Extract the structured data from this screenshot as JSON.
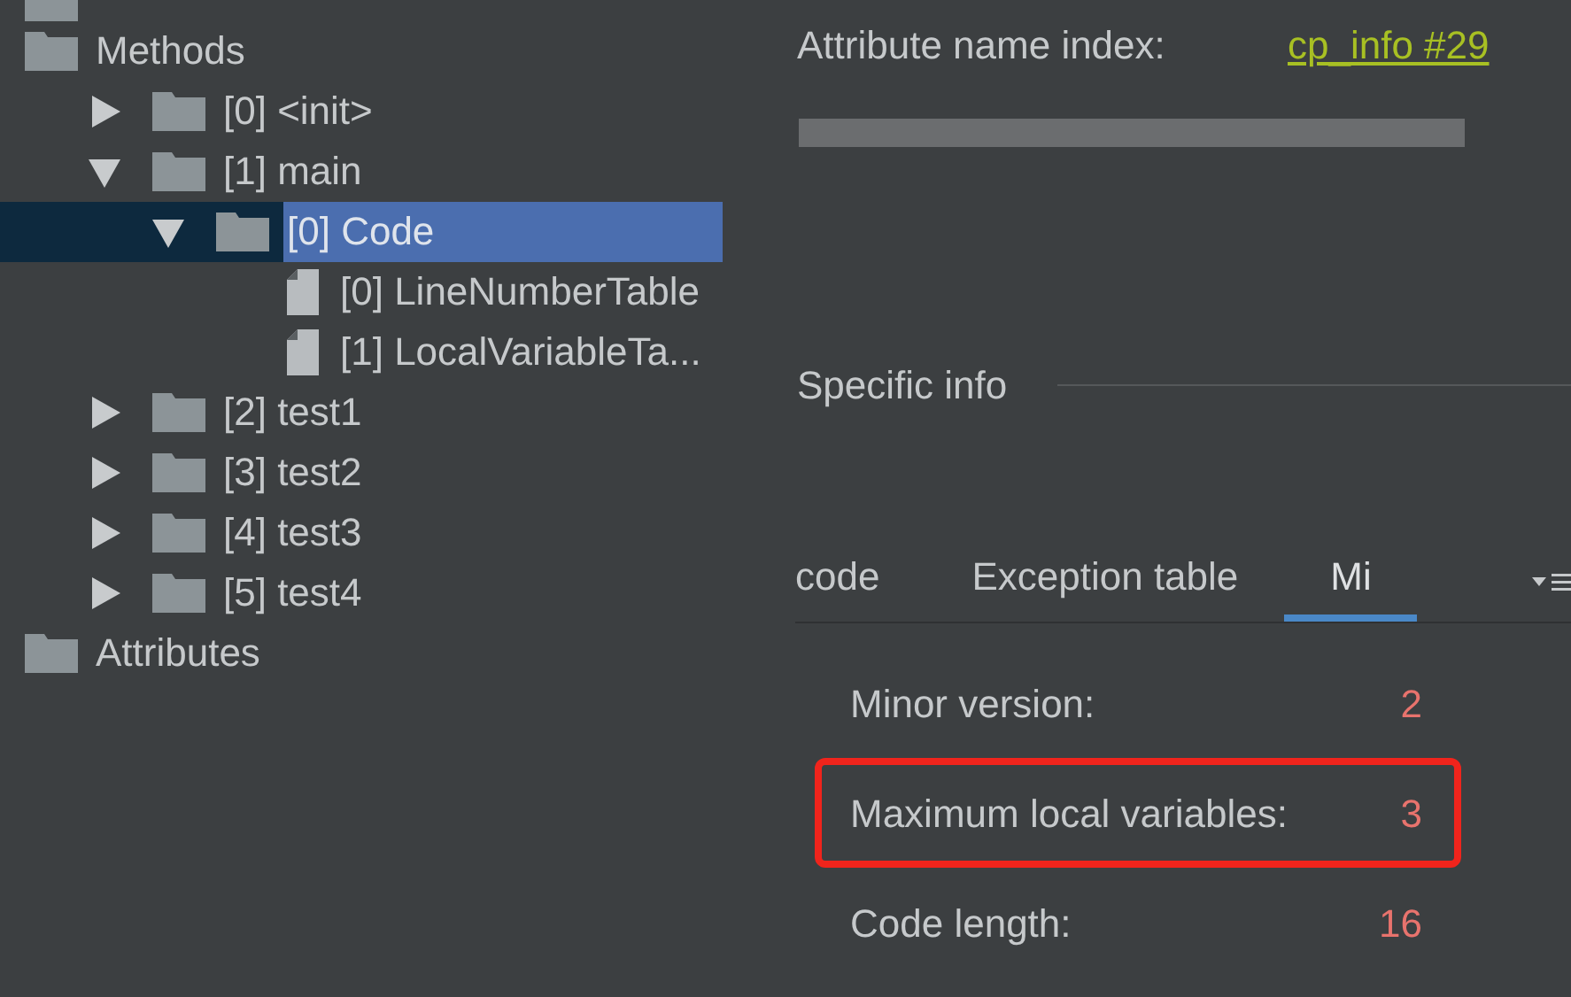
{
  "tree": [
    {
      "label": "Methods",
      "kind": "folder",
      "expanded": true,
      "selected": false,
      "children": [
        {
          "label": "[0] <init>",
          "kind": "folder",
          "expanded": false,
          "selected": false
        },
        {
          "label": "[1] main",
          "kind": "folder",
          "expanded": true,
          "selected": false,
          "children": [
            {
              "label": "[0] Code",
              "kind": "folder",
              "expanded": true,
              "selected": true,
              "children": [
                {
                  "label": "[0] LineNumberTable",
                  "kind": "file",
                  "selected": false
                },
                {
                  "label": "[1] LocalVariableTa...",
                  "kind": "file",
                  "selected": false
                }
              ]
            }
          ]
        },
        {
          "label": "[2] test1",
          "kind": "folder",
          "expanded": false,
          "selected": false
        },
        {
          "label": "[3] test2",
          "kind": "folder",
          "expanded": false,
          "selected": false
        },
        {
          "label": "[4] test3",
          "kind": "folder",
          "expanded": false,
          "selected": false
        },
        {
          "label": "[5] test4",
          "kind": "folder",
          "expanded": false,
          "selected": false
        }
      ]
    },
    {
      "label": "Attributes",
      "kind": "folder",
      "selected": false
    }
  ],
  "attribute": {
    "name_label": "Attribute name index:",
    "name_link": "cp_info #29"
  },
  "specific_info": "Specific info",
  "tabs": [
    {
      "label": "code",
      "selected": false
    },
    {
      "label": "Exception table",
      "selected": false
    },
    {
      "label": "Mi",
      "selected": true
    }
  ],
  "fields": [
    {
      "label": "Minor version:",
      "value": "2",
      "highlighted": false
    },
    {
      "label": "Maximum local variables:",
      "value": "3",
      "highlighted": true
    },
    {
      "label": "Code length:",
      "value": "16",
      "highlighted": false
    }
  ]
}
